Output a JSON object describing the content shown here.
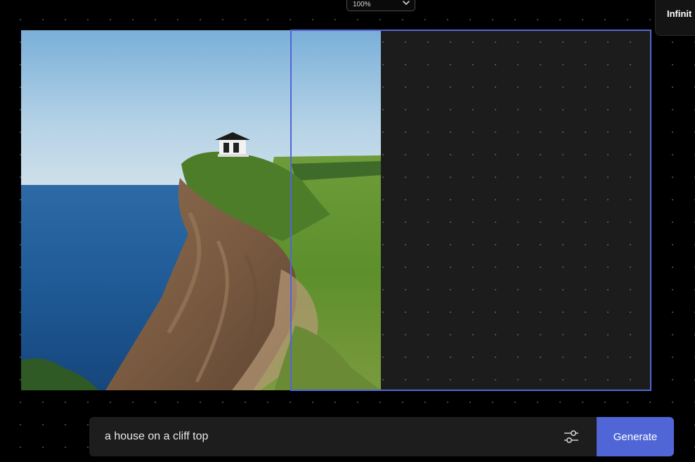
{
  "zoom": {
    "value": "100%",
    "chevron_icon": "chevron-down-icon"
  },
  "brand": {
    "title": "Infinit"
  },
  "canvas": {
    "image_subject": "house on a cliff top above the sea",
    "selection_color": "#5166d6"
  },
  "prompt": {
    "value": "a house on a cliff top",
    "settings_icon": "sliders-icon",
    "generate_label": "Generate"
  },
  "colors": {
    "accent": "#5166d6",
    "background": "#000000",
    "panel": "#1d1d1d"
  }
}
